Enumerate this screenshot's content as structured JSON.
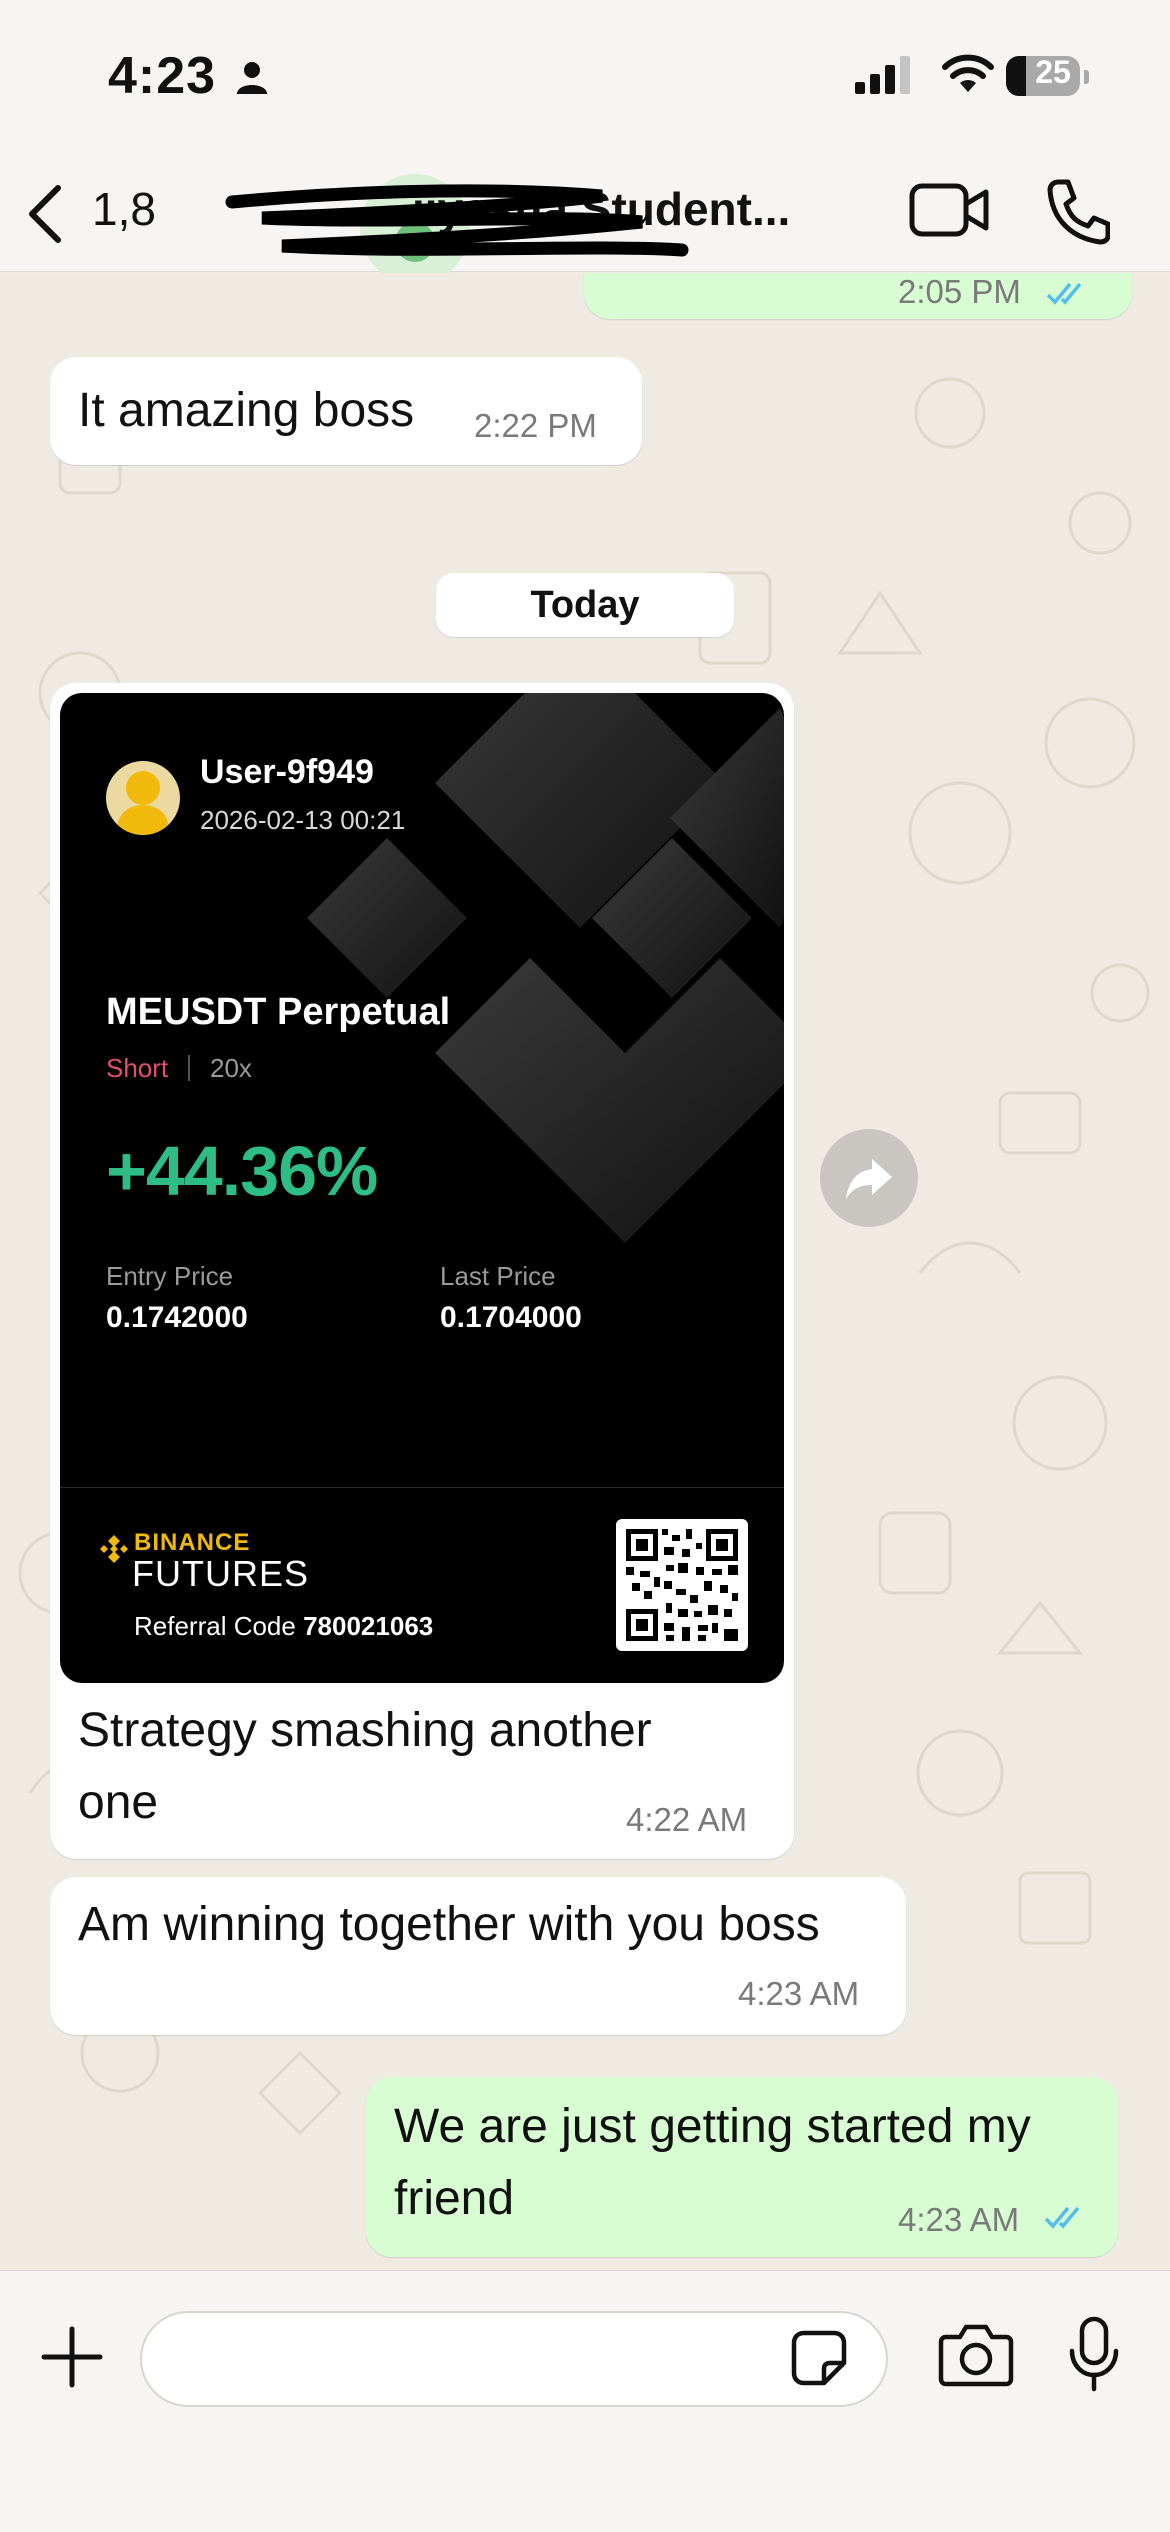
{
  "status_bar": {
    "time": "4:23",
    "battery": "25",
    "battery_level": 0.25
  },
  "header": {
    "contact_prefix": "1,8",
    "contact_name_visible": "Student...",
    "partial_name": "iiyasha"
  },
  "messages": [
    {
      "id": "m0",
      "direction": "outgoing",
      "time": "2:05 PM",
      "read": true
    },
    {
      "id": "m1",
      "direction": "incoming",
      "text": "It amazing boss",
      "time": "2:22 PM"
    },
    {
      "id": "m2",
      "direction": "incoming",
      "text_lines": [
        "Strategy smashing another",
        "one"
      ],
      "time": "4:22 AM"
    },
    {
      "id": "m3",
      "direction": "incoming",
      "text": "Am winning together with you boss",
      "time": "4:23 AM"
    },
    {
      "id": "m4",
      "direction": "outgoing",
      "text_lines": [
        "We are just getting started my",
        "friend"
      ],
      "time": "4:23 AM",
      "read": true
    }
  ],
  "date_divider": "Today",
  "trade_card": {
    "user": "User-9f949",
    "date": "2026-02-13 00:21",
    "pair": "MEUSDT Perpetual",
    "side": "Short",
    "leverage": "20x",
    "pnl": "+44.36%",
    "entry_label": "Entry Price",
    "entry_price": "0.1742000",
    "last_label": "Last Price",
    "last_price": "0.1704000",
    "brand_top": "BINANCE",
    "brand_bottom": "FUTURES",
    "referral_label": "Referral Code",
    "referral_code": "780021063"
  },
  "icons": {
    "back": "chevron-left-icon",
    "video": "video-call-icon",
    "phone": "phone-icon",
    "forward": "forward-icon",
    "plus": "plus-icon",
    "sticker": "sticker-icon",
    "camera": "camera-icon",
    "mic": "microphone-icon"
  },
  "colors": {
    "incoming": "#ffffff",
    "outgoing": "#d9fdd3",
    "read_ticks": "#53bdeb",
    "pnl_green": "#2ebd85",
    "short_red": "#e0526b",
    "binance_yellow": "#f0b90b"
  }
}
